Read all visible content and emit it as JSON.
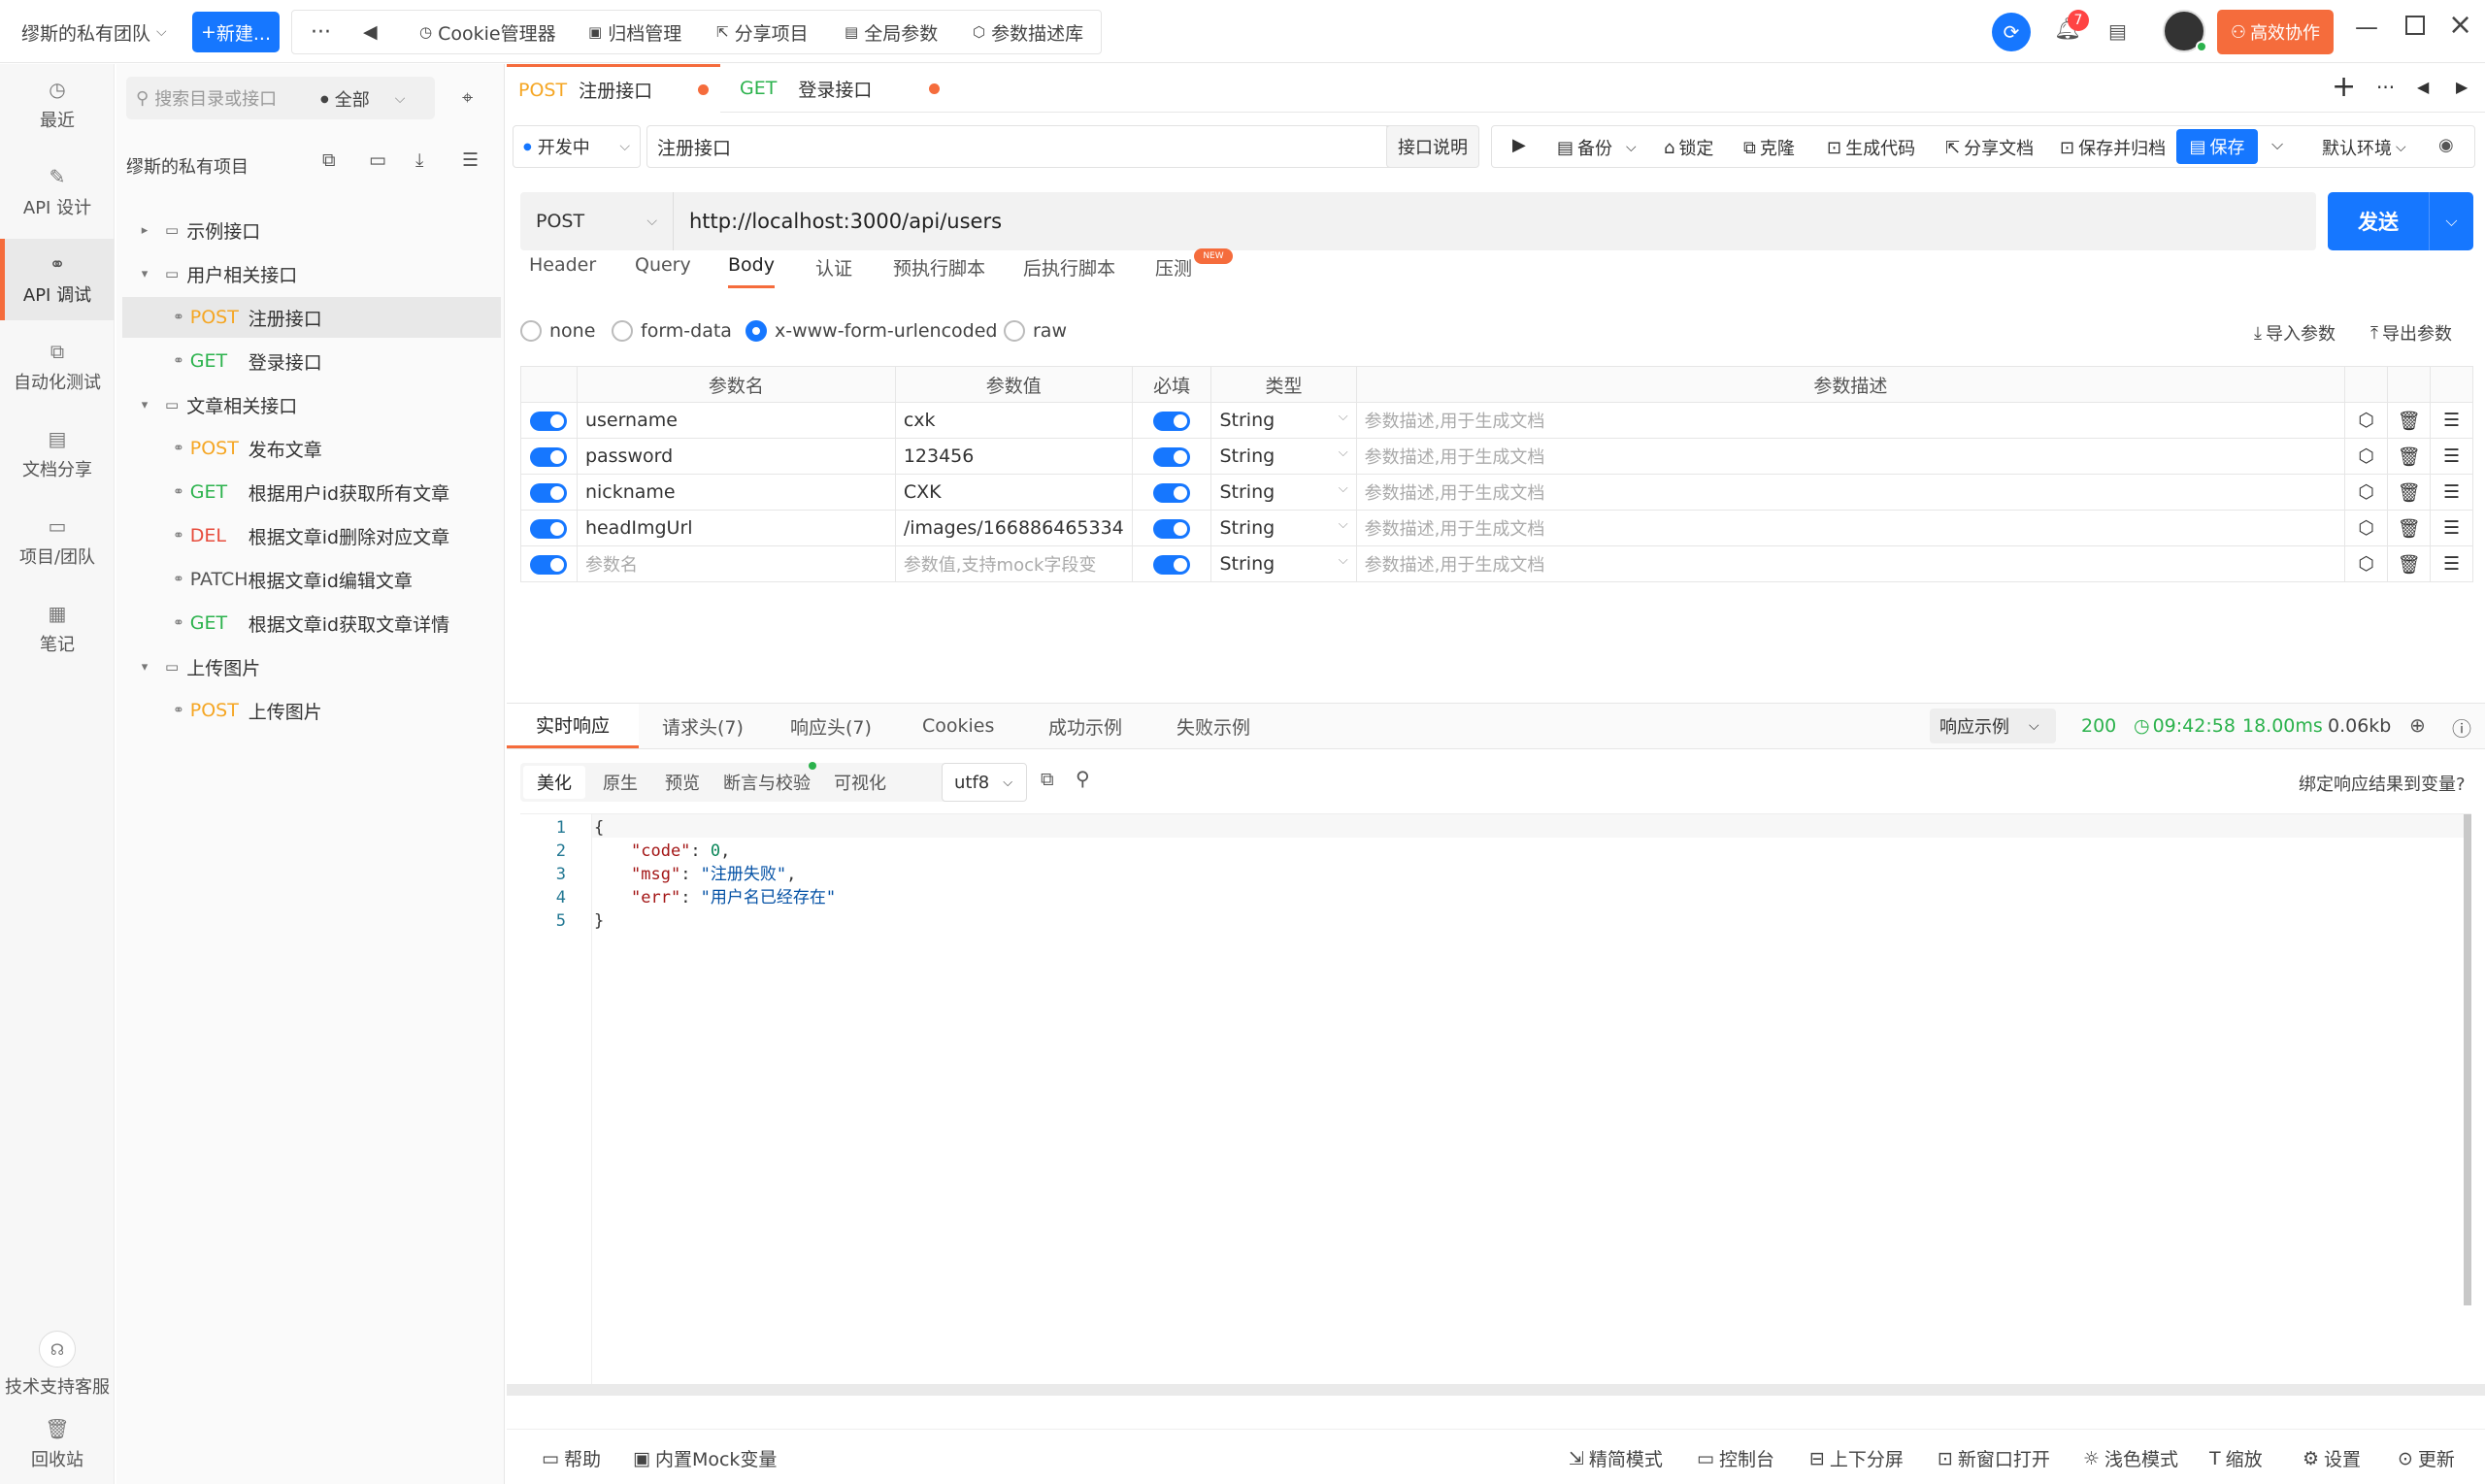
{
  "topbar": {
    "team": "缪斯的私有团队",
    "new_label": "新建...",
    "more": "···",
    "cookie": "Cookie管理器",
    "archive": "归档管理",
    "share": "分享项目",
    "global_params": "全局参数",
    "param_lib": "参数描述库",
    "notify_count": "7",
    "collab": "高效协作"
  },
  "rail": {
    "items": [
      "最近",
      "API 设计",
      "API 调试",
      "自动化测试",
      "文档分享",
      "项目/团队",
      "笔记"
    ],
    "support": "技术支持客服",
    "trash": "回收站"
  },
  "tree": {
    "search_placeholder": "搜索目录或接口",
    "filter": "全部",
    "project": "缪斯的私有项目",
    "nodes": [
      {
        "type": "folder",
        "label": "示例接口"
      },
      {
        "type": "folder",
        "label": "用户相关接口"
      },
      {
        "method": "POST",
        "label": "注册接口"
      },
      {
        "method": "GET",
        "label": "登录接口"
      },
      {
        "type": "folder",
        "label": "文章相关接口"
      },
      {
        "method": "POST",
        "label": "发布文章"
      },
      {
        "method": "GET",
        "label": "根据用户id获取所有文章"
      },
      {
        "method": "DEL",
        "label": "根据文章id删除对应文章"
      },
      {
        "method": "PATCH",
        "label": "根据文章id编辑文章"
      },
      {
        "method": "GET",
        "label": "根据文章id获取文章详情"
      },
      {
        "type": "folder",
        "label": "上传图片"
      },
      {
        "method": "POST",
        "label": "上传图片"
      }
    ]
  },
  "tabs": [
    {
      "method": "POST",
      "name": "注册接口"
    },
    {
      "method": "GET",
      "name": "登录接口"
    }
  ],
  "toolbar": {
    "status": "开发中",
    "api_name": "注册接口",
    "desc_btn": "接口说明",
    "backup": "备份",
    "lock": "锁定",
    "clone": "克隆",
    "gen_code": "生成代码",
    "share_doc": "分享文档",
    "save_archive": "保存并归档",
    "save": "保存",
    "env": "默认环境"
  },
  "request": {
    "method": "POST",
    "url": "http://localhost:3000/api/users",
    "send": "发送"
  },
  "subtabs": [
    "Header",
    "Query",
    "Body",
    "认证",
    "预执行脚本",
    "后执行脚本",
    "压测"
  ],
  "new_badge": "NEW",
  "body_modes": [
    "none",
    "form-data",
    "x-www-form-urlencoded",
    "raw"
  ],
  "import_params": "导入参数",
  "export_params": "导出参数",
  "params_table": {
    "headers": [
      "参数名",
      "参数值",
      "必填",
      "类型",
      "参数描述"
    ],
    "rows": [
      {
        "name": "username",
        "value": "cxk",
        "type": "String",
        "desc": "参数描述,用于生成文档"
      },
      {
        "name": "password",
        "value": "123456",
        "type": "String",
        "desc": "参数描述,用于生成文档"
      },
      {
        "name": "nickname",
        "value": "CXK",
        "type": "String",
        "desc": "参数描述,用于生成文档"
      },
      {
        "name": "headImgUrl",
        "value": "/images/166886465334",
        "type": "String",
        "desc": "参数描述,用于生成文档"
      },
      {
        "name": "参数名",
        "value": "参数值,支持mock字段变",
        "type": "String",
        "desc": "参数描述,用于生成文档"
      }
    ]
  },
  "response": {
    "tabs": [
      "实时响应",
      "请求头(7)",
      "响应头(7)",
      "Cookies",
      "成功示例",
      "失败示例"
    ],
    "example": "响应示例",
    "status": "200",
    "time": "09:42:58",
    "duration": "18.00ms",
    "size": "0.06kb",
    "view_tabs": [
      "美化",
      "原生",
      "预览",
      "断言与校验",
      "可视化"
    ],
    "encoding": "utf8",
    "bind_link": "绑定响应结果到变量?",
    "lines": [
      "1",
      "2",
      "3",
      "4",
      "5"
    ],
    "code_key": "\"code\"",
    "code_val": "0",
    "msg_key": "\"msg\"",
    "msg_val": "\"注册失败\"",
    "err_key": "\"err\"",
    "err_val": "\"用户名已经存在\""
  },
  "footer": {
    "help": "帮助",
    "mock": "内置Mock变量",
    "simple": "精简模式",
    "console": "控制台",
    "split": "上下分屏",
    "newwin": "新窗口打开",
    "theme": "浅色模式",
    "zoom": "缩放",
    "settings": "设置",
    "update": "更新"
  },
  "colors": {
    "accent": "#1677ff",
    "orange": "#f56c3c",
    "post": "#f5a623",
    "get": "#2bb24c",
    "del": "#e74c3c"
  }
}
